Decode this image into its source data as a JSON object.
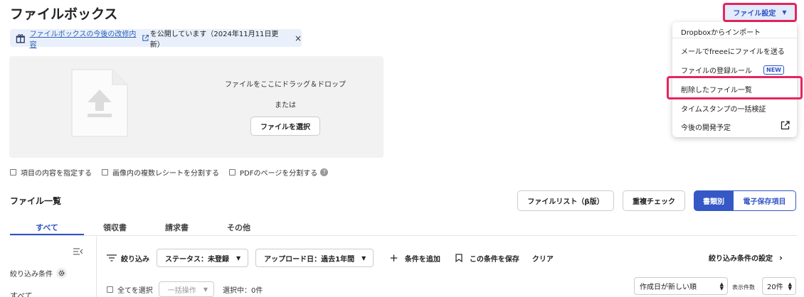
{
  "page": {
    "title": "ファイルボックス"
  },
  "banner": {
    "link_text": "ファイルボックスの今後の改修内容",
    "suffix": "を公開しています（2024年11月11日更新）",
    "close": "×"
  },
  "upload": {
    "instruction": "ファイルをここにドラッグ＆ドロップ",
    "or": "または",
    "select_button": "ファイルを選択"
  },
  "options": [
    {
      "label": "項目の内容を指定する"
    },
    {
      "label": "画像内の複数レシートを分割する"
    },
    {
      "label": "PDFのページを分割する"
    }
  ],
  "file_list": {
    "title": "ファイル一覧",
    "filelist_button": "ファイルリスト（β版）",
    "duplicate_button": "重複チェック",
    "view_toggle": {
      "by_type": "書類別",
      "e_storage": "電子保存項目"
    }
  },
  "tabs": [
    {
      "label": "すべて"
    },
    {
      "label": "領収書"
    },
    {
      "label": "請求書"
    },
    {
      "label": "その他"
    }
  ],
  "sidebar": {
    "filter_conditions": "絞り込み条件",
    "all": "すべて"
  },
  "filters": {
    "filter_label": "絞り込み",
    "status": "ステータス：未登録",
    "upload_date": "アップロード日：過去1年間",
    "add_condition": "条件を追加",
    "save_condition": "この条件を保存",
    "clear": "クリア",
    "filter_settings": "絞り込み条件の設定"
  },
  "list_controls": {
    "select_all": "全てを選択",
    "bulk_action": "一括操作",
    "selected": "選択中：0件",
    "sort": "作成日が新しい順",
    "count_label": "表示件数",
    "count": "20件"
  },
  "settings": {
    "button": "ファイル設定",
    "menu": [
      {
        "label": "Dropboxからインポート"
      },
      {
        "label": "メールでfreeeにファイルを送る"
      },
      {
        "label": "ファイルの登録ルール",
        "badge": "NEW"
      },
      {
        "label": "削除したファイル一覧"
      },
      {
        "label": "タイムスタンプの一括検証"
      },
      {
        "label": "今後の開発予定"
      }
    ]
  },
  "colors": {
    "accent": "#3558c6",
    "highlight": "#e8245f",
    "banner_bg": "#e9f0fb"
  }
}
